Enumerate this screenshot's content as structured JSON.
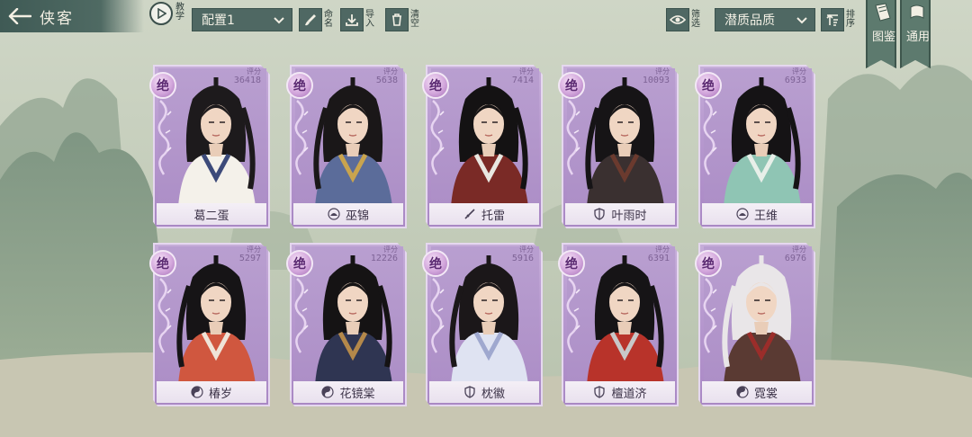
{
  "header": {
    "title": "侠客",
    "tutorial_label": "教学",
    "config_value": "配置1",
    "rename_label": "命名",
    "import_label": "导入",
    "clear_label": "清空",
    "filter_label": "筛选",
    "quality_value": "潜质品质",
    "sort_label": "排序",
    "tab_codex": "图鉴",
    "tab_general": "通用"
  },
  "colors": {
    "card_purple": "#b89ad0",
    "bar_teal": "#4f6863",
    "rank_text": "#5b2a72"
  },
  "heroes": [
    {
      "rank": "绝",
      "score_label": "评分",
      "score": "36418",
      "name": "葛二蛋",
      "school_icon": "none",
      "hair": "#1d1a1c",
      "robe": "#f4f1ea",
      "accent": "#3c4a7a"
    },
    {
      "rank": "绝",
      "score_label": "评分",
      "score": "5638",
      "name": "巫锦",
      "school_icon": "lotus-icon",
      "hair": "#1a1718",
      "robe": "#5b6c9a",
      "accent": "#c9a44e"
    },
    {
      "rank": "绝",
      "score_label": "评分",
      "score": "7414",
      "name": "托雷",
      "school_icon": "blade-icon",
      "hair": "#141213",
      "robe": "#7a2a26",
      "accent": "#e9e7e1"
    },
    {
      "rank": "绝",
      "score_label": "评分",
      "score": "10093",
      "name": "叶雨时",
      "school_icon": "shield-icon",
      "hair": "#161416",
      "robe": "#3a3030",
      "accent": "#6b3a2e"
    },
    {
      "rank": "绝",
      "score_label": "评分",
      "score": "6933",
      "name": "王维",
      "school_icon": "lotus-icon",
      "hair": "#151315",
      "robe": "#8fc5b4",
      "accent": "#e8efe9"
    },
    {
      "rank": "绝",
      "score_label": "评分",
      "score": "5297",
      "name": "椿岁",
      "school_icon": "taiji-icon",
      "hair": "#161416",
      "robe": "#d0573f",
      "accent": "#efe4d8"
    },
    {
      "rank": "绝",
      "score_label": "评分",
      "score": "12226",
      "name": "花镜棠",
      "school_icon": "taiji-icon",
      "hair": "#151314",
      "robe": "#2f3552",
      "accent": "#b4884a"
    },
    {
      "rank": "绝",
      "score_label": "评分",
      "score": "5916",
      "name": "枕徽",
      "school_icon": "shield-icon",
      "hair": "#1b1719",
      "robe": "#dfe3f2",
      "accent": "#9fa8cf"
    },
    {
      "rank": "绝",
      "score_label": "评分",
      "score": "6391",
      "name": "檀道济",
      "school_icon": "shield-icon",
      "hair": "#161416",
      "robe": "#b8332a",
      "accent": "#c8c8c8"
    },
    {
      "rank": "绝",
      "score_label": "评分",
      "score": "6976",
      "name": "霓裳",
      "school_icon": "taiji-icon",
      "hair": "#e9e6e8",
      "robe": "#5a3a33",
      "accent": "#9b2d2a"
    }
  ]
}
